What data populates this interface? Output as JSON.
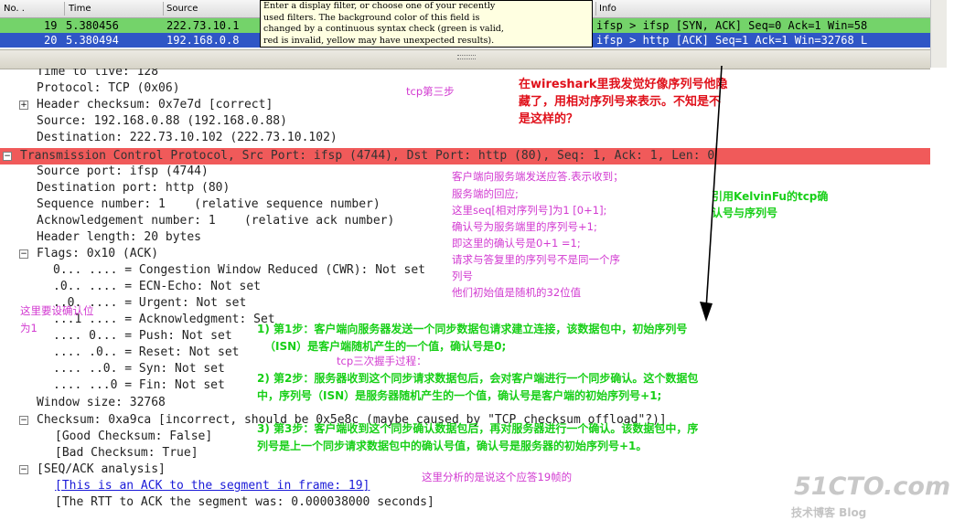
{
  "packet_list": {
    "columns": [
      "No. .",
      "Time",
      "Source",
      "Info"
    ],
    "rows": [
      {
        "no": "19",
        "time": "5.380456",
        "source": "222.73.10.1",
        "info": "ifsp > ifsp [SYN, ACK] Seq=0 Ack=1 Win=58"
      },
      {
        "no": "20",
        "time": "5.380494",
        "source": "192.168.0.8",
        "info": "ifsp > http [ACK] Seq=1 Ack=1 Win=32768 L"
      }
    ]
  },
  "tooltip": {
    "lines": [
      "Enter a display filter, or choose one of your recently",
      "used filters. The background color of this field is",
      "changed by a continuous syntax check (green is valid,",
      "red is invalid, yellow may have unexpected results)."
    ]
  },
  "detail": {
    "ttl": "Time to live: 128",
    "protocol": "Protocol: TCP (0x06)",
    "header_checksum": "Header checksum: 0x7e7d [correct]",
    "source": "Source: 192.168.0.88 (192.168.0.88)",
    "destination": "Destination: 222.73.10.102 (222.73.10.102)",
    "tcp_title": "Transmission Control Protocol, Src Port: ifsp (4744), Dst Port: http (80), Seq: 1, Ack: 1, Len: 0",
    "src_port": "Source port: ifsp (4744)",
    "dst_port": "Destination port: http (80)",
    "seq": "Sequence number: 1    (relative sequence number)",
    "ack": "Acknowledgement number: 1    (relative ack number)",
    "header_len": "Header length: 20 bytes",
    "flags": "Flags: 0x10 (ACK)",
    "cwr": "0... .... = Congestion Window Reduced (CWR): Not set",
    "ece": ".0.. .... = ECN-Echo: Not set",
    "urg": "..0. .... = Urgent: Not set",
    "ackflag": "...1 .... = Acknowledgment: Set",
    "psh": ".... 0... = Push: Not set",
    "rst": ".... .0.. = Reset: Not set",
    "syn": ".... ..0. = Syn: Not set",
    "fin": ".... ...0 = Fin: Not set",
    "window": "Window size: 32768",
    "checksum": "Checksum: 0xa9ca [incorrect, should be 0x5e8c (maybe caused by \"TCP checksum offload\"?)]",
    "good": "[Good Checksum: False]",
    "bad": "[Bad Checksum: True]",
    "seqack": "[SEQ/ACK analysis]",
    "ackof": "[This is an ACK to the segment in frame: 19]",
    "rtt": "[The RTT to ACK the segment was: 0.000038000 seconds]"
  },
  "notes": {
    "third_step": "tcp第三步",
    "red_1": "在wireshark里我发觉好像序列号他隐",
    "red_2": "藏了，用相对序列号来表示。不知是不",
    "red_3": "是这样的？",
    "pink_block": [
      "客户端向服务端发送应答.表示收到；",
      "服务端的回应;",
      "这里seq[相对序列号]为1  [0+1];",
      "确认号为服务端里的序列号+1;",
      "即这里的确认号是0+1 =1;",
      "请求与答复里的序列号不是同一个序",
      "列号",
      "他们初始值是随机的32位值"
    ],
    "green_ref_1": "引用KelvinFu的tcp确",
    "green_ref_2": "认号与序列号",
    "confirm_1": "这里要设确认位",
    "confirm_2": "为1",
    "handshake_title": "tcp三次握手过程：",
    "step1_a": "1)   第1步：客户端向服务器发送一个同步数据包请求建立连接，该数据包中，初始序列号",
    "step1_b": "（ISN）是客户端随机产生的一个值，确认号是0;",
    "step2_a": "2)   第2步：服务器收到这个同步请求数据包后，会对客户端进行一个同步确认。这个数据包",
    "step2_b": "中，序列号（ISN）是服务器随机产生的一个值，确认号是客户端的初始序列号+1;",
    "step3_a": "3)   第3步：客户端收到这个同步确认数据包后，再对服务器进行一个确认。该数据包中，序",
    "step3_b": "列号是上一个同步请求数据包中的确认号值，确认号是服务器的初始序列号+1。",
    "frame_note": "这里分析的是说这个应答19帧的"
  },
  "watermark": {
    "brand": "51CTO.com",
    "sub": "技术博客  Blog"
  },
  "colors": {
    "tcp_bar": "#f05a5a",
    "row19": "#74d36a",
    "row20": "#2f56c6",
    "pink": "#d23bd1",
    "green": "#17cf17",
    "red": "#e0101a"
  }
}
